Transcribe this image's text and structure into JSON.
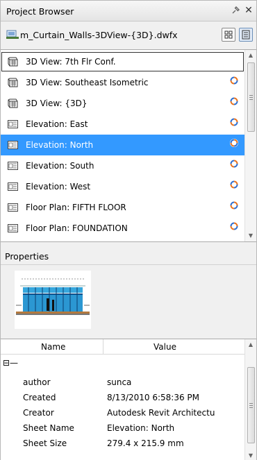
{
  "titlebar": {
    "title": "Project Browser",
    "pin_icon": "pin-icon",
    "close_icon": "close-icon"
  },
  "file": {
    "name": "m_Curtain_Walls-3DView-{3D}.dwfx",
    "icon": "model-file-icon"
  },
  "view_buttons": [
    {
      "name": "thumbnail-view-button"
    },
    {
      "name": "list-view-button"
    }
  ],
  "browser": {
    "items": [
      {
        "label": "3D View: 7th Flr Conf.",
        "icon": "3d-view-icon",
        "sync": false
      },
      {
        "label": "3D View: Southeast Isometric",
        "icon": "3d-view-icon",
        "sync": true
      },
      {
        "label": "3D View: {3D}",
        "icon": "3d-view-icon",
        "sync": true
      },
      {
        "label": "Elevation: East",
        "icon": "sheet-view-icon",
        "sync": true
      },
      {
        "label": "Elevation: North",
        "icon": "sheet-view-icon",
        "sync": true
      },
      {
        "label": "Elevation: South",
        "icon": "sheet-view-icon",
        "sync": true
      },
      {
        "label": "Elevation: West",
        "icon": "sheet-view-icon",
        "sync": true
      },
      {
        "label": "Floor Plan: FIFTH FLOOR",
        "icon": "sheet-view-icon",
        "sync": true
      },
      {
        "label": "Floor Plan: FOUNDATION",
        "icon": "sheet-view-icon",
        "sync": true
      }
    ],
    "selected_index": 4,
    "focused_index": 0
  },
  "properties": {
    "title": "Properties",
    "preview": "elevation-thumbnail",
    "columns": {
      "name": "Name",
      "value": "Value"
    },
    "group_label": "⊟—",
    "rows": [
      {
        "name": "author",
        "value": "sunca"
      },
      {
        "name": "Created",
        "value": "8/13/2010 6:58:36 PM"
      },
      {
        "name": "Creator",
        "value": "Autodesk Revit Architectu"
      },
      {
        "name": "Sheet Name",
        "value": "Elevation: North"
      },
      {
        "name": "Sheet Size",
        "value": "279.4 x 215.9 mm"
      }
    ]
  },
  "colors": {
    "selection": "#3399ff",
    "sync_orange": "#e8731f",
    "sync_blue": "#2f6fd0"
  }
}
